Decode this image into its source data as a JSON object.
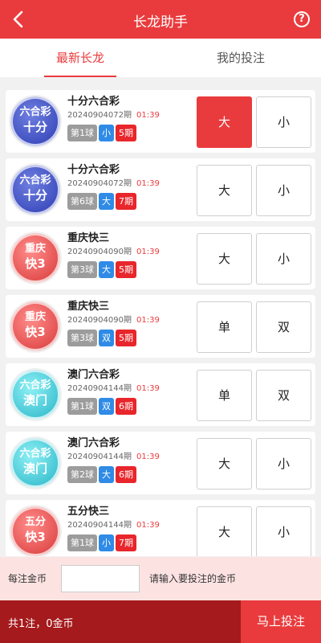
{
  "header": {
    "title": "长龙助手",
    "help_icon_text": "?"
  },
  "tabs": [
    {
      "label": "最新长龙"
    },
    {
      "label": "我的投注"
    }
  ],
  "colors": {
    "brand": "#e93b3d",
    "bottom_bar": "#a51a1c"
  },
  "items": [
    {
      "logo": {
        "line1": "六合彩",
        "line2": "十分",
        "theme": "blue"
      },
      "name": "十分六合彩",
      "issue": "20240904072期",
      "time": "01:39",
      "ball": "第1球",
      "result": "小",
      "streak": "5期",
      "options": [
        "大",
        "小"
      ]
    },
    {
      "logo": {
        "line1": "六合彩",
        "line2": "十分",
        "theme": "blue"
      },
      "name": "十分六合彩",
      "issue": "20240904072期",
      "time": "01:39",
      "ball": "第6球",
      "result": "大",
      "streak": "7期",
      "options": [
        "大",
        "小"
      ]
    },
    {
      "logo": {
        "line1": "重庆",
        "line2": "快3",
        "theme": "red"
      },
      "name": "重庆快三",
      "issue": "20240904090期",
      "time": "01:39",
      "ball": "第3球",
      "result": "大",
      "streak": "5期",
      "options": [
        "大",
        "小"
      ]
    },
    {
      "logo": {
        "line1": "重庆",
        "line2": "快3",
        "theme": "red"
      },
      "name": "重庆快三",
      "issue": "20240904090期",
      "time": "01:39",
      "ball": "第3球",
      "result": "双",
      "streak": "5期",
      "options": [
        "单",
        "双"
      ]
    },
    {
      "logo": {
        "line1": "六合彩",
        "line2": "澳门",
        "theme": "cyan"
      },
      "name": "澳门六合彩",
      "issue": "20240904144期",
      "time": "01:39",
      "ball": "第1球",
      "result": "双",
      "streak": "6期",
      "options": [
        "单",
        "双"
      ]
    },
    {
      "logo": {
        "line1": "六合彩",
        "line2": "澳门",
        "theme": "cyan"
      },
      "name": "澳门六合彩",
      "issue": "20240904144期",
      "time": "01:39",
      "ball": "第2球",
      "result": "大",
      "streak": "6期",
      "options": [
        "大",
        "小"
      ]
    },
    {
      "logo": {
        "line1": "五分",
        "line2": "快3",
        "theme": "red"
      },
      "name": "五分快三",
      "issue": "20240904144期",
      "time": "01:39",
      "ball": "第1球",
      "result": "小",
      "streak": "7期",
      "options": [
        "大",
        "小"
      ]
    }
  ],
  "selected": {
    "item": 1,
    "option": 1
  },
  "stake": {
    "label": "每注金币",
    "value": "",
    "hint": "请输入要投注的金币"
  },
  "footer": {
    "summary": "共1注，0金币",
    "submit_label": "马上投注"
  }
}
